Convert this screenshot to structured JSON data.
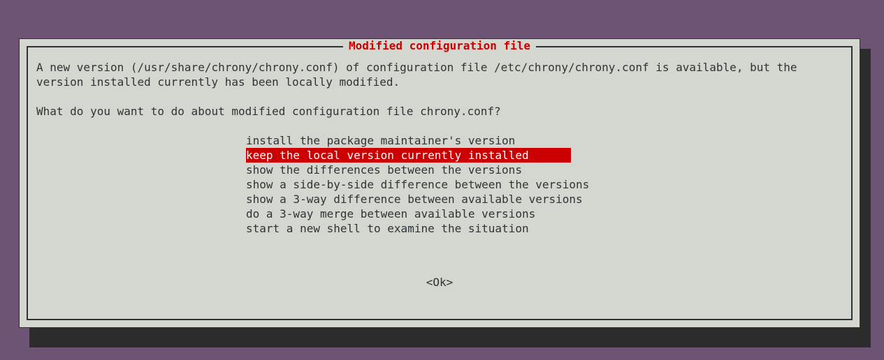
{
  "dialog": {
    "title": "Modified configuration file",
    "message": "A new version (/usr/share/chrony/chrony.conf) of configuration file /etc/chrony/chrony.conf is available, but the version installed currently has been locally modified.",
    "question": "What do you want to do about modified configuration file chrony.conf?",
    "options": [
      "install the package maintainer's version",
      "keep the local version currently installed",
      "show the differences between the versions",
      "show a side-by-side difference between the versions",
      "show a 3-way difference between available versions",
      "do a 3-way merge between available versions",
      "start a new shell to examine the situation"
    ],
    "selected_index": 1,
    "ok_label": "<Ok>"
  }
}
